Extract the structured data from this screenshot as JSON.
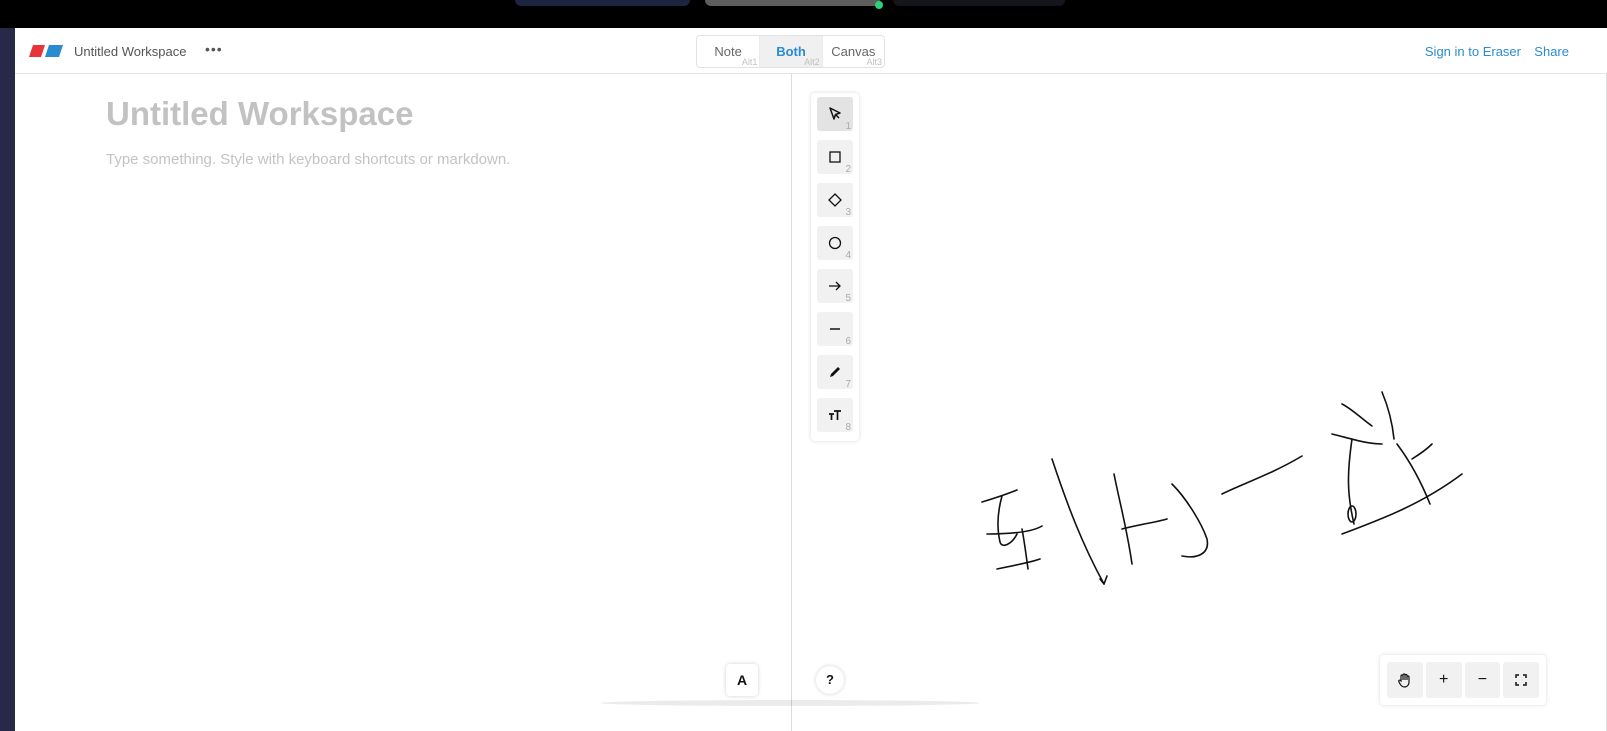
{
  "app": {
    "title": "Untitled Workspace",
    "more_label": "•••",
    "brand_colors": {
      "logo_red": "#e8333b",
      "logo_blue": "#2a8bd0"
    }
  },
  "mode_switch": {
    "selected": "Both",
    "modes": [
      {
        "label": "Note",
        "hint": "Alt1"
      },
      {
        "label": "Both",
        "hint": "Alt2"
      },
      {
        "label": "Canvas",
        "hint": "Alt3"
      }
    ]
  },
  "header_actions": {
    "signin_label": "Sign in to Eraser",
    "share_label": "Share"
  },
  "note": {
    "title": "Untitled Workspace",
    "placeholder": "Type something. Style with keyboard shortcuts or markdown.",
    "font_button_label": "A"
  },
  "canvas": {
    "tools": [
      {
        "icon": "pointer-icon",
        "shortcut": "1"
      },
      {
        "icon": "rectangle-icon",
        "shortcut": "2"
      },
      {
        "icon": "diamond-icon",
        "shortcut": "3"
      },
      {
        "icon": "circle-icon",
        "shortcut": "4"
      },
      {
        "icon": "arrow-icon",
        "shortcut": "5"
      },
      {
        "icon": "line-icon",
        "shortcut": "6"
      },
      {
        "icon": "pencil-icon",
        "shortcut": "7"
      },
      {
        "icon": "text-icon",
        "shortcut": "8"
      }
    ],
    "active_tool": "pointer-icon",
    "help_label": "?",
    "zoom": {
      "hand_icon": "hand-icon",
      "zoom_in_label": "+",
      "zoom_out_label": "−",
      "fit_icon": "fullscreen-icon"
    },
    "accent_color": "#2a8bd0"
  }
}
